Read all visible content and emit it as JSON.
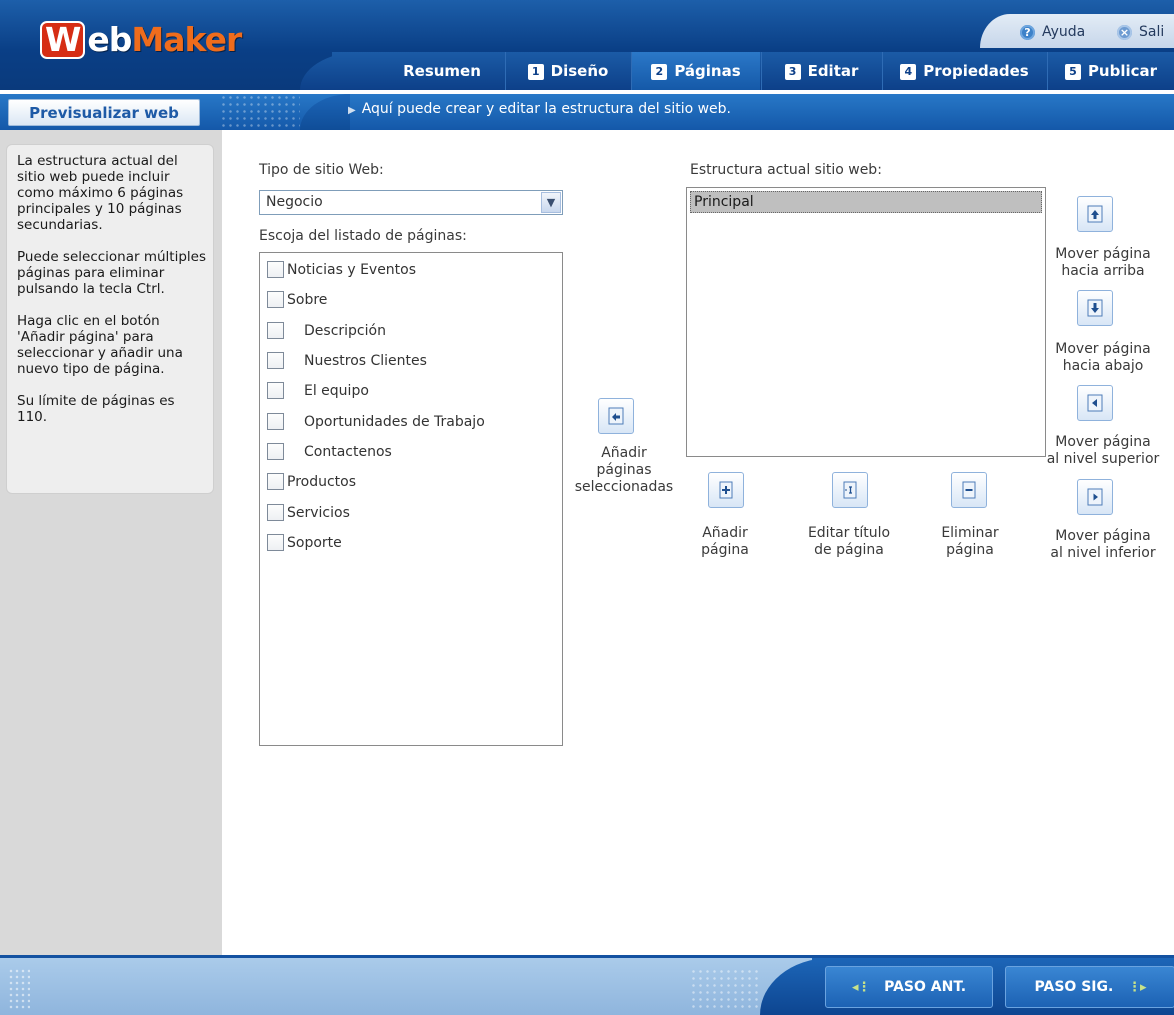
{
  "app": {
    "logo_first": "Web",
    "logo_second": "Maker"
  },
  "topbar": {
    "help_label": "Ayuda",
    "exit_label": "Sali"
  },
  "tabs": [
    {
      "num": "",
      "label": "Resumen",
      "active": false
    },
    {
      "num": "1",
      "label": "Diseño",
      "active": false
    },
    {
      "num": "2",
      "label": "Páginas",
      "active": true
    },
    {
      "num": "3",
      "label": "Editar",
      "active": false
    },
    {
      "num": "4",
      "label": "Propiedades",
      "active": false
    },
    {
      "num": "5",
      "label": "Publicar",
      "active": false
    }
  ],
  "subheader": {
    "preview_label": "Previsualizar web",
    "info_text": "Aquí puede crear y editar la estructura del sitio web."
  },
  "sidebar": {
    "paragraphs": [
      "La estructura actual del sitio web puede incluir como máximo 6 páginas principales y 10 páginas secundarias.",
      "Puede seleccionar múltiples páginas para eliminar pulsando la tecla Ctrl.",
      "Haga clic en el botón 'Añadir página' para seleccionar y añadir una nuevo tipo de página.",
      "Su límite de páginas es 110."
    ]
  },
  "main": {
    "site_type_label": "Tipo de sitio Web:",
    "site_type_value": "Negocio",
    "page_list_label": "Escoja del listado de páginas:",
    "page_list": [
      {
        "label": "Noticias y Eventos",
        "sub": false
      },
      {
        "label": "Sobre",
        "sub": false
      },
      {
        "label": "Descripción",
        "sub": true
      },
      {
        "label": "Nuestros Clientes",
        "sub": true
      },
      {
        "label": "El equipo",
        "sub": true
      },
      {
        "label": "Oportunidades de Trabajo",
        "sub": true
      },
      {
        "label": "Contactenos",
        "sub": true
      },
      {
        "label": "Productos",
        "sub": false
      },
      {
        "label": "Servicios",
        "sub": false
      },
      {
        "label": "Soporte",
        "sub": false
      }
    ],
    "add_selected_lines": [
      "Añadir",
      "páginas",
      "seleccionadas"
    ],
    "structure_label": "Estructura actual sitio web:",
    "structure_items": [
      "Principal"
    ],
    "add_page_lines": [
      "Añadir",
      "página"
    ],
    "edit_title_lines": [
      "Editar título",
      "de página"
    ],
    "delete_page_lines": [
      "Eliminar",
      "página"
    ],
    "move_up_lines": [
      "Mover página",
      "hacia arriba"
    ],
    "move_down_lines": [
      "Mover página",
      "hacia abajo"
    ],
    "move_upper_level_lines": [
      "Mover página",
      "al nivel superior"
    ],
    "move_lower_level_lines": [
      "Mover página",
      "al nivel inferior"
    ]
  },
  "footer": {
    "prev_label": "PASO ANT.",
    "next_label": "PASO SIG."
  },
  "colors": {
    "header_blue": "#0a3f86",
    "tab_active": "#1f6bbd",
    "sidebar_gray": "#d9d9d9",
    "logo_red": "#d62d14",
    "logo_orange": "#ef6c1c"
  }
}
